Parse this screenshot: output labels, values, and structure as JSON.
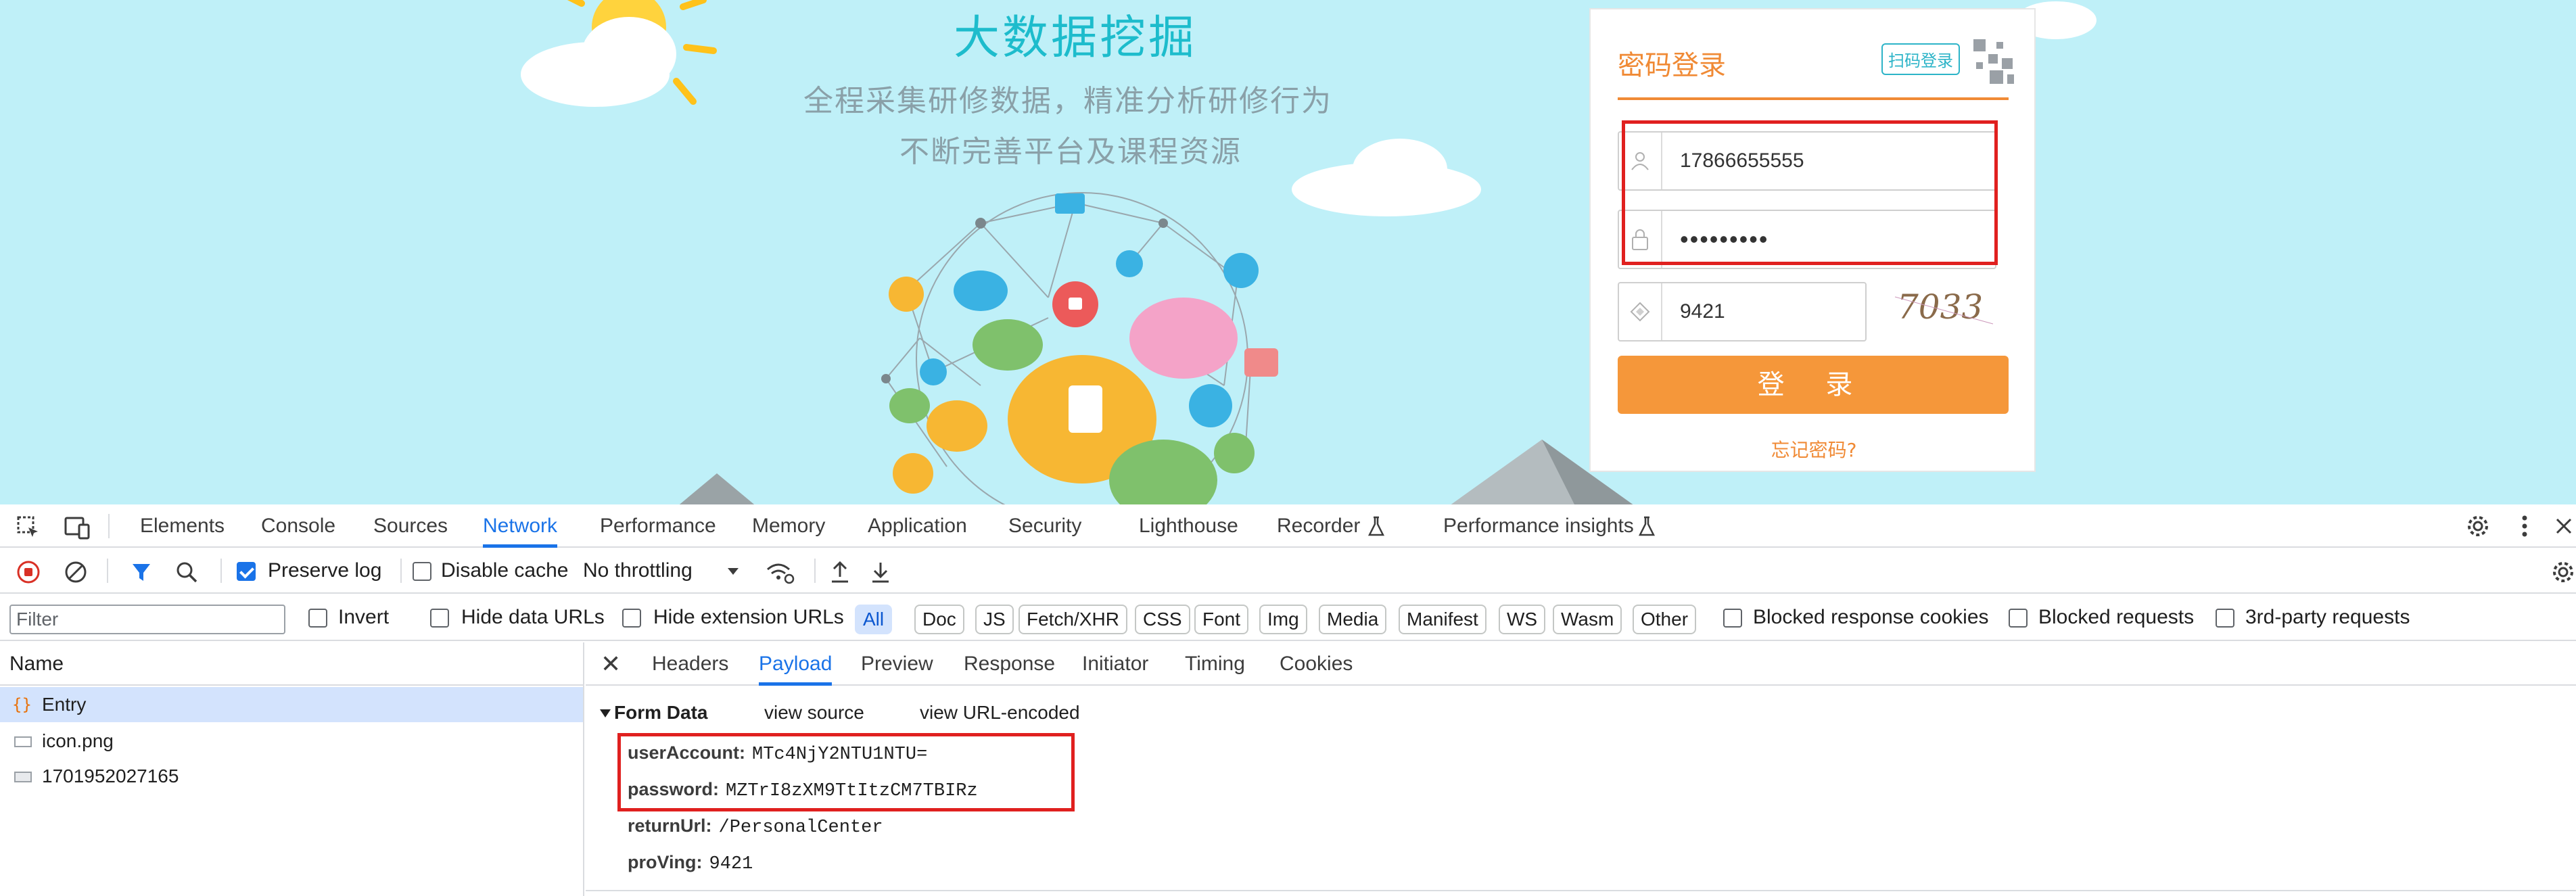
{
  "page": {
    "hero_title": "大数据挖掘",
    "hero_line1": "全程采集研修数据，精准分析研修行为",
    "hero_line2": "不断完善平台及课程资源",
    "login": {
      "title": "密码登录",
      "qr_label": "扫码登录",
      "username_value": "17866655555",
      "password_value": "•••••••••",
      "captcha_value": "9421",
      "captcha_image_text": "7033",
      "submit_label": "登 录",
      "forgot_label": "忘记密码?"
    }
  },
  "devtools": {
    "tabs": [
      "Elements",
      "Console",
      "Sources",
      "Network",
      "Performance",
      "Memory",
      "Application",
      "Security",
      "Lighthouse",
      "Recorder",
      "Performance insights"
    ],
    "active_tab": "Network",
    "toolbar": {
      "preserve_log_label": "Preserve log",
      "preserve_log_checked": true,
      "disable_cache_label": "Disable cache",
      "throttling_value": "No throttling"
    },
    "filter": {
      "placeholder": "Filter",
      "invert_label": "Invert",
      "hide_data_urls_label": "Hide data URLs",
      "hide_extension_urls_label": "Hide extension URLs",
      "types": [
        "All",
        "Doc",
        "JS",
        "Fetch/XHR",
        "CSS",
        "Font",
        "Img",
        "Media",
        "Manifest",
        "WS",
        "Wasm",
        "Other"
      ],
      "blocked_cookies_label": "Blocked response cookies",
      "blocked_requests_label": "Blocked requests",
      "third_party_label": "3rd-party requests"
    },
    "requests": {
      "header": "Name",
      "items": [
        "Entry",
        "icon.png",
        "1701952027165"
      ]
    },
    "detail": {
      "close_glyph": "✕",
      "tabs": [
        "Headers",
        "Payload",
        "Preview",
        "Response",
        "Initiator",
        "Timing",
        "Cookies"
      ],
      "active_tab": "Payload",
      "form_data_label": "Form Data",
      "view_source_label": "view source",
      "view_url_encoded_label": "view URL-encoded",
      "fields": [
        {
          "key": "userAccount:",
          "value": "MTc4NjY2NTU1NTU="
        },
        {
          "key": "password:",
          "value": "MZTrI8zXM9TtItzCM7TBIRz"
        },
        {
          "key": "returnUrl:",
          "value": "/PersonalCenter"
        },
        {
          "key": "proVing:",
          "value": "9421"
        }
      ]
    }
  },
  "colors": {
    "page_bg": "#bff0f8",
    "accent_orange": "#f5973a",
    "devtools_blue": "#1a73e8",
    "highlight_red": "#e0201f"
  }
}
